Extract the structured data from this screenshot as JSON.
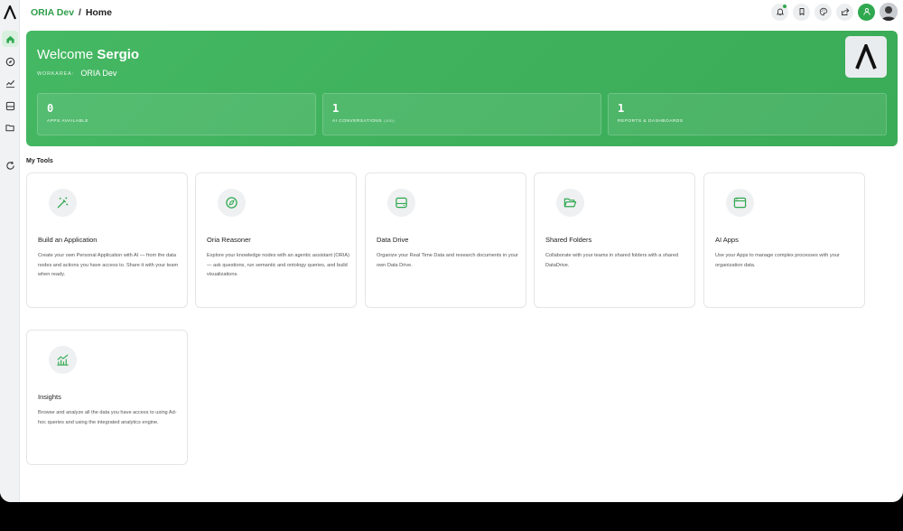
{
  "header": {
    "workspace": "ORIA Dev",
    "separator": "/",
    "page": "Home"
  },
  "hero": {
    "welcome_prefix": "Welcome",
    "user_name": "Sergio",
    "workarea_label": "WORKAREA:",
    "workarea_value": "ORIA Dev",
    "stats": [
      {
        "value": "0",
        "label": "APPS AVAILABLE",
        "sublabel": ""
      },
      {
        "value": "1",
        "label": "AI CONVERSATIONS",
        "sublabel": "(30D)"
      },
      {
        "value": "1",
        "label": "REPORTS & DASHBOARDS",
        "sublabel": ""
      }
    ]
  },
  "tools": {
    "title": "My Tools",
    "items": [
      {
        "title": "Build an Application",
        "icon": "magic-wand-icon",
        "description": "Create your own Personal Application with AI — from the data nodes and actions you have access to. Share it with your team when ready."
      },
      {
        "title": "Oria Reasoner",
        "icon": "compass-icon",
        "description": "Explore your knowledge nodes with an agentic assistant (ORIA) — ask questions, run semantic and ontology queries, and build visualizations."
      },
      {
        "title": "Data Drive",
        "icon": "drive-icon",
        "description": "Organize your Real Time Data and research documents in your own Data Drive."
      },
      {
        "title": "Shared Folders",
        "icon": "folder-open-icon",
        "description": "Collaborate with your teams in shared folders with a shared DataDrive."
      },
      {
        "title": "AI Apps",
        "icon": "app-window-icon",
        "description": "Use your Apps to manage complex processes with your organization data."
      },
      {
        "title": "Insights",
        "icon": "chart-line-icon",
        "description": "Browse and analyze all the data you have access to using Ad-hoc queries and using the integrated analytics engine."
      }
    ]
  },
  "colors": {
    "accent": "#2fa84f",
    "hero": "#43b661"
  }
}
